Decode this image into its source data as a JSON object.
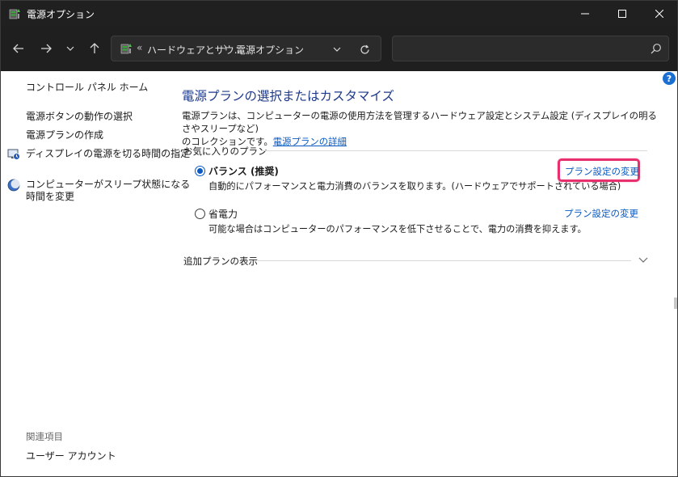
{
  "window": {
    "title": "電源オプション"
  },
  "nav": {
    "address_crumb_prefix": "«",
    "address_crumb_1": "ハードウェアとサウ...",
    "address_separator": "›",
    "address_crumb_2": "電源オプション",
    "search_placeholder": ""
  },
  "sidebar": {
    "links": [
      {
        "label": "コントロール パネル ホーム"
      },
      {
        "label": "電源ボタンの動作の選択"
      },
      {
        "label": "電源プランの作成"
      },
      {
        "label": "ディスプレイの電源を切る時間の指定"
      },
      {
        "label": "コンピューターがスリープ状態になる"
      },
      {
        "label": "時間を変更"
      }
    ],
    "related_label": "関連項目",
    "related_link": "ユーザー アカウント"
  },
  "main": {
    "title": "電源プランの選択またはカスタマイズ",
    "desc_line1": "電源プランは、コンピューターの電源の使用方法を管理するハードウェア設定とシステム設定 (ディスプレイの明るさやスリープなど)",
    "desc_line2": "のコレクションです。",
    "desc_link": "電源プランの詳細",
    "favorites_label": "お気に入りのプラン",
    "plans": [
      {
        "name": "バランス (推奨)",
        "desc": "自動的にパフォーマンスと電力消費のバランスを取ります。(ハードウェアでサポートされている場合)",
        "link": "プラン設定の変更",
        "selected": true
      },
      {
        "name": "省電力",
        "desc": "可能な場合はコンピューターのパフォーマンスを低下させることで、電力の消費を抑えます。",
        "link": "プラン設定の変更",
        "selected": false
      }
    ],
    "additional_label": "追加プランの表示",
    "help": "?"
  },
  "colors": {
    "titlebar": "#202020",
    "link": "#0a5ac2",
    "title": "#1e3a8a",
    "highlight": "#e8306e"
  },
  "icons": [
    "power-options-icon",
    "minimize-icon",
    "maximize-icon",
    "close-icon",
    "back-arrow-icon",
    "forward-arrow-icon",
    "chevron-down-icon",
    "up-arrow-icon",
    "refresh-icon",
    "search-icon",
    "help-icon",
    "display-power-icon",
    "sleep-icon"
  ]
}
